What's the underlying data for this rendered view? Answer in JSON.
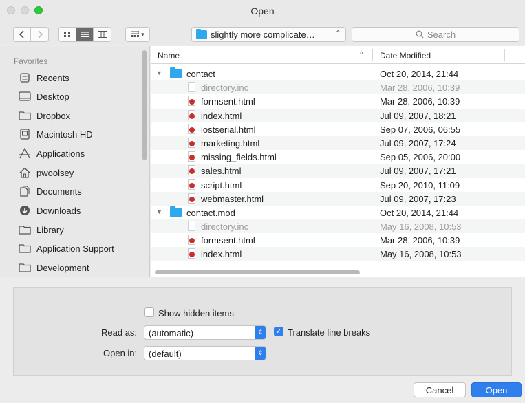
{
  "window": {
    "title": "Open"
  },
  "toolbar": {
    "back_icon": "chevron-left-icon",
    "forward_icon": "chevron-right-icon",
    "location": "slightly more complicate…",
    "search_placeholder": "Search"
  },
  "sidebar": {
    "section_title": "Favorites",
    "items": [
      {
        "label": "Recents",
        "icon": "recents-icon"
      },
      {
        "label": "Desktop",
        "icon": "desktop-icon"
      },
      {
        "label": "Dropbox",
        "icon": "folder-icon"
      },
      {
        "label": "Macintosh HD",
        "icon": "hard-drive-icon"
      },
      {
        "label": "Applications",
        "icon": "applications-icon"
      },
      {
        "label": "pwoolsey",
        "icon": "home-icon"
      },
      {
        "label": "Documents",
        "icon": "documents-icon"
      },
      {
        "label": "Downloads",
        "icon": "downloads-icon"
      },
      {
        "label": "Library",
        "icon": "folder-icon"
      },
      {
        "label": "Application Support",
        "icon": "folder-icon"
      },
      {
        "label": "Development",
        "icon": "folder-icon"
      }
    ]
  },
  "filelist": {
    "columns": {
      "name": "Name",
      "date": "Date Modified"
    },
    "rows": [
      {
        "kind": "folder",
        "name": "contact",
        "date": "Oct 20, 2014, 21:44"
      },
      {
        "kind": "inc",
        "name": "directory.inc",
        "date": "Mar 28, 2006, 10:39"
      },
      {
        "kind": "html",
        "name": "formsent.html",
        "date": "Mar 28, 2006, 10:39"
      },
      {
        "kind": "html",
        "name": "index.html",
        "date": "Jul 09, 2007, 18:21"
      },
      {
        "kind": "html",
        "name": "lostserial.html",
        "date": "Sep 07, 2006, 06:55"
      },
      {
        "kind": "html",
        "name": "marketing.html",
        "date": "Jul 09, 2007, 17:24"
      },
      {
        "kind": "html",
        "name": "missing_fields.html",
        "date": "Sep 05, 2006, 20:00"
      },
      {
        "kind": "html",
        "name": "sales.html",
        "date": "Jul 09, 2007, 17:21"
      },
      {
        "kind": "html",
        "name": "script.html",
        "date": "Sep 20, 2010, 11:09"
      },
      {
        "kind": "html",
        "name": "webmaster.html",
        "date": "Jul 09, 2007, 17:23"
      },
      {
        "kind": "folder",
        "name": "contact.mod",
        "date": "Oct 20, 2014, 21:44"
      },
      {
        "kind": "inc",
        "name": "directory.inc",
        "date": "May 16, 2008, 10:53"
      },
      {
        "kind": "html",
        "name": "formsent.html",
        "date": "Mar 28, 2006, 10:39"
      },
      {
        "kind": "html",
        "name": "index.html",
        "date": "May 16, 2008, 10:53"
      }
    ]
  },
  "options": {
    "show_hidden_label": "Show hidden items",
    "show_hidden_checked": false,
    "read_as_label": "Read as:",
    "read_as_value": "(automatic)",
    "translate_label": "Translate line breaks",
    "translate_checked": true,
    "open_in_label": "Open in:",
    "open_in_value": "(default)"
  },
  "buttons": {
    "cancel": "Cancel",
    "open": "Open"
  },
  "colors": {
    "accent": "#2f80ed",
    "folder": "#2fa8ee"
  }
}
